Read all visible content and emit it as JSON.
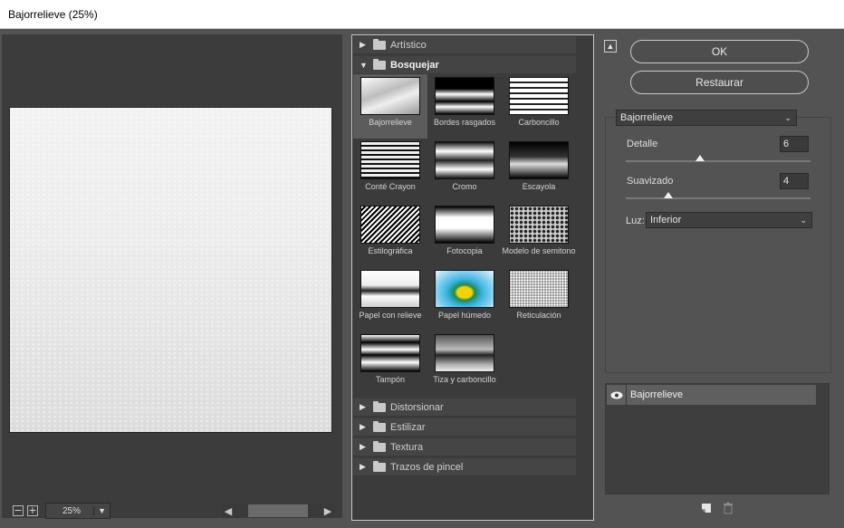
{
  "window": {
    "title": "Bajorrelieve (25%)"
  },
  "preview": {
    "zoom_value": "25%",
    "zoom_out_icon": "minus-square-icon",
    "zoom_in_icon": "plus-square-icon"
  },
  "gallery": {
    "categories_top": [
      {
        "label": "Artístico",
        "expanded": false
      }
    ],
    "open_category": {
      "label": "Bosquejar",
      "expanded": true
    },
    "filters": [
      {
        "label": "Bajorrelieve",
        "selected": true
      },
      {
        "label": "Bordes rasgados",
        "selected": false
      },
      {
        "label": "Carboncillo",
        "selected": false
      },
      {
        "label": "Conté Crayon",
        "selected": false
      },
      {
        "label": "Cromo",
        "selected": false
      },
      {
        "label": "Escayola",
        "selected": false
      },
      {
        "label": "Estilográfica",
        "selected": false
      },
      {
        "label": "Fotocopia",
        "selected": false
      },
      {
        "label": "Modelo de semitono",
        "selected": false
      },
      {
        "label": "Papel con relieve",
        "selected": false
      },
      {
        "label": "Papel húmedo",
        "selected": false
      },
      {
        "label": "Reticulación",
        "selected": false
      },
      {
        "label": "Tampón",
        "selected": false
      },
      {
        "label": "Tiza y carboncillo",
        "selected": false
      }
    ],
    "categories_bottom": [
      {
        "label": "Distorsionar"
      },
      {
        "label": "Estilizar"
      },
      {
        "label": "Textura"
      },
      {
        "label": "Trazos de pincel"
      }
    ]
  },
  "actions": {
    "ok_label": "OK",
    "reset_label": "Restaurar"
  },
  "settings": {
    "filter_select": "Bajorrelieve",
    "detail_label": "Detalle",
    "detail_value": "6",
    "detail_fraction": 0.4,
    "smooth_label": "Suavizado",
    "smooth_value": "4",
    "smooth_fraction": 0.23,
    "light_label": "Luz:",
    "light_value": "Inferior"
  },
  "layers": {
    "items": [
      {
        "label": "Bajorrelieve",
        "visible": true
      }
    ]
  },
  "colors": {
    "panel": "#535353",
    "dark": "#3b3b3b",
    "accent_border": "#c8c8c8"
  }
}
